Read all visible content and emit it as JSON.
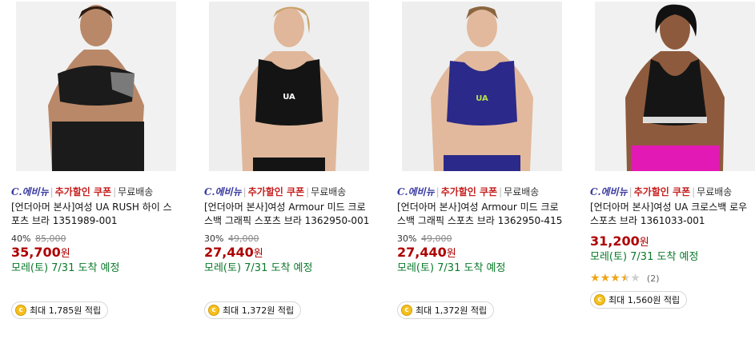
{
  "products": [
    {
      "shop": "C.에비뉴",
      "coupon": "추가할인 쿠폰",
      "shipping": "무료배송",
      "title_line1": "[언더아머 본사]여성 UA RUSH 하이 스",
      "title_line2": "포츠 브라 1351989-001",
      "discount_pct": "40%",
      "original_price": "85,000",
      "price": "35,700",
      "currency": "원",
      "delivery": "모레(토) 7/31 도착 예정",
      "reward": "최대 1,785원 적립",
      "image_colors": {
        "bg": "#f1f1f1",
        "top": "#1b1b1b",
        "accent": "#7a7a7a",
        "skin": "#b98868"
      }
    },
    {
      "shop": "C.에비뉴",
      "coupon": "추가할인 쿠폰",
      "shipping": "무료배송",
      "title_line1": "[언더아머 본사]여성 Armour 미드 크로",
      "title_line2": "스백 그래픽 스포츠 브라 1362950-001",
      "discount_pct": "30%",
      "original_price": "49,000",
      "price": "27,440",
      "currency": "원",
      "delivery": "모레(토) 7/31 도착 예정",
      "reward": "최대 1,372원 적립",
      "image_colors": {
        "bg": "#eeeeee",
        "top": "#141414",
        "accent": "#ffffff",
        "skin": "#e0b79a"
      }
    },
    {
      "shop": "C.에비뉴",
      "coupon": "추가할인 쿠폰",
      "shipping": "무료배송",
      "title_line1": "[언더아머 본사]여성 Armour 미드 크로",
      "title_line2": "스백 그래픽 스포츠 브라 1362950-415",
      "discount_pct": "30%",
      "original_price": "49,000",
      "price": "27,440",
      "currency": "원",
      "delivery": "모레(토) 7/31 도착 예정",
      "reward": "최대 1,372원 적립",
      "image_colors": {
        "bg": "#eeeeee",
        "top": "#2b2a8a",
        "accent": "#b5e24a",
        "skin": "#e2b99c"
      }
    },
    {
      "shop": "C.에비뉴",
      "coupon": "추가할인 쿠폰",
      "shipping": "무료배송",
      "title_line1": "[언더아머 본사]여성 UA 크로스백 로우",
      "title_line2": "스포츠 브라 1361033-001",
      "price": "31,200",
      "currency": "원",
      "delivery": "모레(토) 7/31 도착 예정",
      "rating": 3.5,
      "review_count": "(2)",
      "reward": "최대 1,560원 적립",
      "image_colors": {
        "bg": "#f1f1f1",
        "top": "#151515",
        "accent": "#e319b5",
        "skin": "#8e5a3d"
      }
    }
  ],
  "colors": {
    "coupon": "#c6201f",
    "price": "#ae0000",
    "delivery": "#0a7a2a",
    "shop": "#3a3aa0",
    "star": "#f0a515"
  }
}
